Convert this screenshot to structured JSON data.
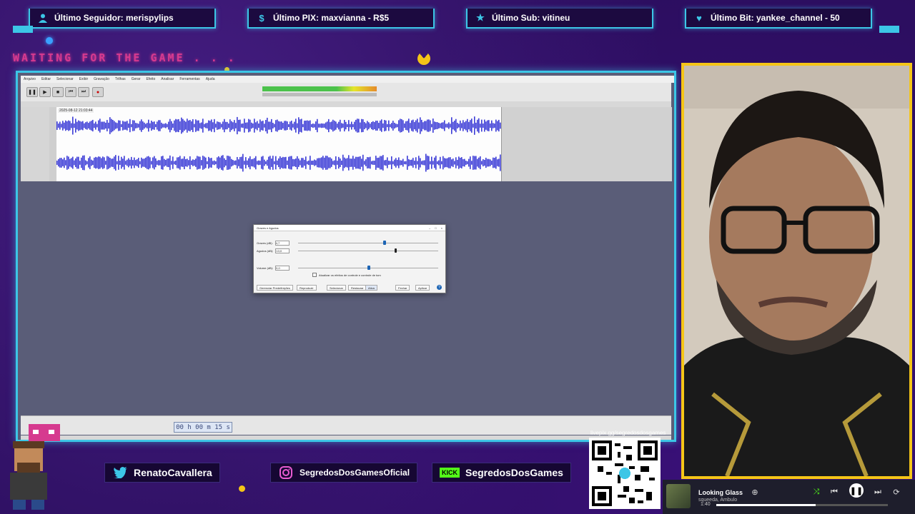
{
  "alerts": [
    {
      "icon": "user-icon",
      "label": "Último Seguidor: merispylips"
    },
    {
      "icon": "dollar-icon",
      "label": "Último PIX: maxvianna - R$5"
    },
    {
      "icon": "star-icon",
      "label": "Último Sub: vitineu"
    },
    {
      "icon": "heart-icon",
      "label": "Último Bit: yankee_channel - 50"
    }
  ],
  "banner": {
    "waiting": "WAITING FOR THE GAME . . ."
  },
  "audacity": {
    "track_time": "2025-08-12 21:03:44",
    "time_counter": "00 h 00 m 15 s",
    "dialog": {
      "title": "Graves e Agudos",
      "labels": [
        "Graves (dB):",
        "Agudos (dB):",
        "Volume (dB):"
      ],
      "values": [
        "4,7",
        "13,0",
        "0,0"
      ],
      "checkbox": "Atualizar os efeitos de controle e controle de tom",
      "buttons": [
        "Gerenciar Predefinições",
        "Reproduzir",
        "Selecionar",
        "Restaurar",
        "Ativa",
        "Fechar",
        "Aplicar"
      ]
    }
  },
  "socials": {
    "twitter": "RenatoCavallera",
    "instagram": "SegredosDosGamesOficial",
    "kick_badge": "KICK",
    "kick": "SegredosDosGames"
  },
  "qr": {
    "label": "livepix.gg/segredosdosgames"
  },
  "player": {
    "song": "Looking Glass",
    "artist": "squeeda, Ambulo",
    "time": "1:40",
    "progress": 0.58
  },
  "colors": {
    "accent": "#3cc6e6",
    "gold": "#f5c517",
    "magenta": "#d63a8f",
    "bg": "#2b0e5e"
  }
}
